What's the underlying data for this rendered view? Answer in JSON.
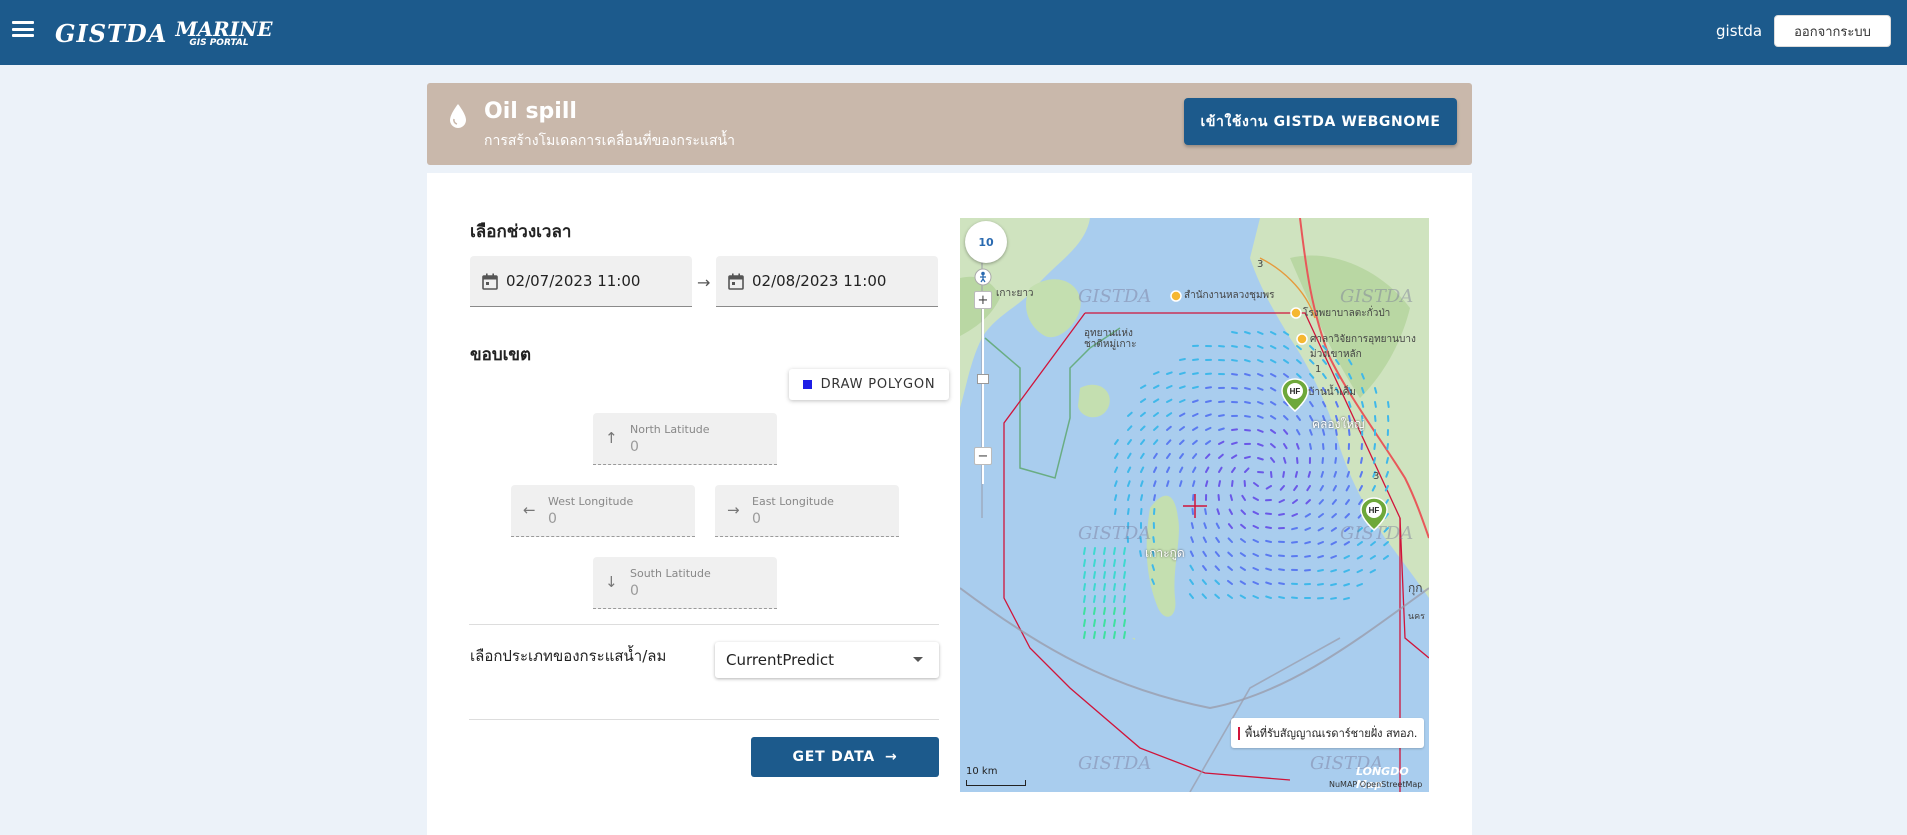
{
  "header": {
    "logo_primary": "GISTDA",
    "logo_secondary": "MARINE",
    "logo_sub": "GIS PORTAL",
    "username": "gistda",
    "logout_label": "ออกจากระบบ"
  },
  "banner": {
    "title": "Oil spill",
    "subtitle": "การสร้างโมเดลการเคลื่อนที่ของกระแสน้ำ",
    "webgnome_label": "เข้าใช้งาน GISTDA WEBGNOME",
    "color": "#c9b8ab"
  },
  "form": {
    "time_section_title": "เลือกช่วงเวลา",
    "start_datetime": "02/07/2023 11:00",
    "end_datetime": "02/08/2023 11:00",
    "range_arrow": "→",
    "bounds_section_title": "ขอบเขต",
    "draw_polygon_label": "DRAW POLYGON",
    "north": {
      "arrow": "↑",
      "label": "North Latitude",
      "value": "0"
    },
    "west": {
      "arrow": "←",
      "label": "West Longitude",
      "value": "0"
    },
    "east": {
      "arrow": "→",
      "label": "East Longitude",
      "value": "0"
    },
    "south": {
      "arrow": "↓",
      "label": "South Latitude",
      "value": "0"
    },
    "type_label": "เลือกประเภทของกระแสน้ำ/ลม",
    "type_selected": "CurrentPredict",
    "get_data_label": "GET DATA",
    "get_data_arrow": "→"
  },
  "map": {
    "zoom_level": "10",
    "zoom_in": "+",
    "zoom_out": "−",
    "watermark": "GISTDA",
    "places": {
      "koh_yao": "เกาะยาว",
      "national_park": "อุทยานแห่งชาติหมู่เกาะ",
      "office": "สำนักงานหลวงชุมพร",
      "hospital": "โรงพยาบาลตะกั่วป่า",
      "research": "ศาลาวิจัยการอุทยานบางม่วงเขาหลัก",
      "ban_nam_khem": "บ้านน้ำเค็ม",
      "khlong_yai": "คลองใหญ่",
      "koh_kut": "เกาะกูด",
      "kuk": "กุก",
      "right_edge": "นคร"
    },
    "road_numbers": [
      "3",
      "1",
      "3"
    ],
    "pin_label": "HF",
    "legend_text": "พื้นที่รับสัญญาณเรดาร์ชายฝั่ง สทอภ.",
    "scale_label": "10 km",
    "attribution_logo": "LONGDO Map",
    "attribution_text": "NuMAP OpenStreetMap",
    "coverage_color": "#d0143a"
  }
}
